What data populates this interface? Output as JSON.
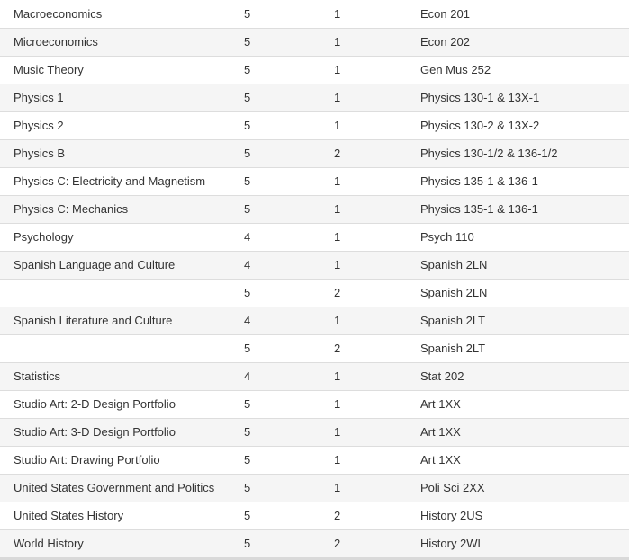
{
  "table": {
    "rows": [
      {
        "subject": "Macroeconomics",
        "score": "5",
        "units": "1",
        "course": "Econ 201"
      },
      {
        "subject": "Microeconomics",
        "score": "5",
        "units": "1",
        "course": "Econ 202"
      },
      {
        "subject": "Music Theory",
        "score": "5",
        "units": "1",
        "course": "Gen Mus 252"
      },
      {
        "subject": "Physics 1",
        "score": "5",
        "units": "1",
        "course": "Physics 130-1 & 13X-1"
      },
      {
        "subject": "Physics 2",
        "score": "5",
        "units": "1",
        "course": "Physics 130-2 & 13X-2"
      },
      {
        "subject": "Physics B",
        "score": "5",
        "units": "2",
        "course": "Physics 130-1/2 & 136-1/2"
      },
      {
        "subject": "Physics C: Electricity and Magnetism",
        "score": "5",
        "units": "1",
        "course": "Physics 135-1 & 136-1"
      },
      {
        "subject": "Physics C: Mechanics",
        "score": "5",
        "units": "1",
        "course": "Physics 135-1 & 136-1"
      },
      {
        "subject": "Psychology",
        "score": "4",
        "units": "1",
        "course": "Psych 110"
      },
      {
        "subject": "Spanish Language and Culture",
        "score": "4",
        "units": "1",
        "course": "Spanish 2LN"
      },
      {
        "subject": "",
        "score": "5",
        "units": "2",
        "course": "Spanish 2LN"
      },
      {
        "subject": "Spanish Literature and Culture",
        "score": "4",
        "units": "1",
        "course": "Spanish 2LT"
      },
      {
        "subject": "",
        "score": "5",
        "units": "2",
        "course": "Spanish 2LT"
      },
      {
        "subject": "Statistics",
        "score": "4",
        "units": "1",
        "course": "Stat 202"
      },
      {
        "subject": "Studio Art: 2-D Design Portfolio",
        "score": "5",
        "units": "1",
        "course": "Art 1XX"
      },
      {
        "subject": "Studio Art: 3-D Design Portfolio",
        "score": "5",
        "units": "1",
        "course": "Art 1XX"
      },
      {
        "subject": "Studio Art: Drawing Portfolio",
        "score": "5",
        "units": "1",
        "course": "Art 1XX"
      },
      {
        "subject": "United States Government and Politics",
        "score": "5",
        "units": "1",
        "course": "Poli Sci 2XX"
      },
      {
        "subject": "United States History",
        "score": "5",
        "units": "2",
        "course": "History 2US"
      },
      {
        "subject": "World History",
        "score": "5",
        "units": "2",
        "course": "History 2WL"
      }
    ]
  }
}
